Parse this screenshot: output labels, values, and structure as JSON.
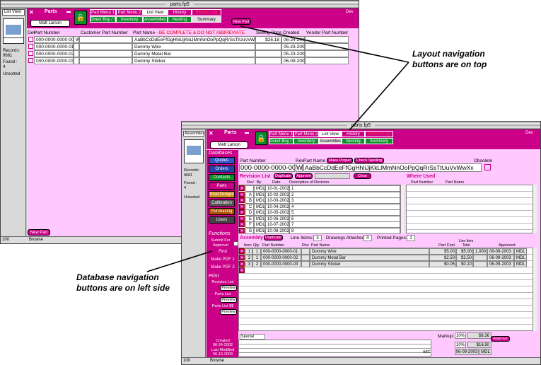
{
  "back_window": {
    "title": "parts.fp5",
    "layout_menu": "List View",
    "records_label": "Records:",
    "records_value": "9681",
    "found_label": "Found :",
    "found_value": "4",
    "sort_status": "Unsorted",
    "zoom": "100",
    "mode": "Browse",
    "app_label": "Parts",
    "user_button": "Matt Larson",
    "dev": "Dev",
    "new_part": "New Part",
    "new_part_small": "New Part",
    "tabs_row1": [
      "Part Menu 1",
      "Part Menu 2",
      "List View",
      "History",
      "Record Log"
    ],
    "tabs_row2": [
      "Direct Buy / Subcon",
      "Inventory",
      "Assemblies",
      "Nesting",
      "Summary"
    ],
    "columns": [
      "Part Number",
      "Customer Part Number",
      "Part Name - BE COMPLETE & DO NOT ABBREVIATE",
      "Selling Price",
      "Created",
      "Vendor Part Number"
    ],
    "col_prefix": "Dev",
    "rows": [
      {
        "pn": "000-0000-0000-00",
        "flag": "W",
        "cpn": "",
        "name": "AaBbCcDdEeFfGgHhIiJjKkLlMmNnOoPpQqRrSsTtUuVvWwXx",
        "price": "$26.18",
        "created": "06-24-2002",
        "vendor": ""
      },
      {
        "pn": "000-0000-0000-01",
        "flag": "",
        "cpn": "",
        "name": "Dummy Wire",
        "price": "",
        "created": "05-23-2003",
        "vendor": ""
      },
      {
        "pn": "000-0000-0000-02",
        "flag": "",
        "cpn": "",
        "name": "Dummy Metal Bar",
        "price": "",
        "created": "05-23-2003",
        "vendor": ""
      },
      {
        "pn": "000-0000-0000-03",
        "flag": "",
        "cpn": "",
        "name": "Dummy Sticker",
        "price": "",
        "created": "06-09-2003",
        "vendor": ""
      }
    ]
  },
  "front_window": {
    "title": "parts.fp5",
    "layout_menu": "Assemblies",
    "records_label": "Records:",
    "records_value": "9681",
    "found_label": "Found :",
    "found_value": "4",
    "sort_status": "Unsorted",
    "zoom": "100",
    "mode": "Browse",
    "app_label": "Parts",
    "user_button": "Matt Larson",
    "dev": "Dev",
    "tabs_row1": [
      "Part Menu 1",
      "Part Menu 2",
      "List View",
      "History",
      "Record Log"
    ],
    "tabs_row2": [
      "Direct Buy / Subcon",
      "Inventory",
      "Assemblies",
      "Nesting",
      "Summary"
    ],
    "databases_heading": "Databases",
    "databases": [
      {
        "label": "Quotes",
        "color": "#3355cc"
      },
      {
        "label": "Orders",
        "color": "#2244aa"
      },
      {
        "label": "Contacts",
        "color": "#0a8f2a"
      },
      {
        "label": "Parts",
        "color": "#cc0088"
      },
      {
        "label": "Prod Groups",
        "color": "#d09020"
      },
      {
        "label": "Calibration",
        "color": "#555555"
      },
      {
        "label": "Purchasing",
        "color": "#b05000"
      },
      {
        "label": "Users",
        "color": "#444444"
      }
    ],
    "functions_heading": "Functions",
    "functions": [
      "Submit For Approval",
      "Find",
      "Make PDF 1",
      "Make PDF 2"
    ],
    "print_heading": "Print",
    "print_items": [
      "Revision List",
      "Parts List",
      "Parts List $$"
    ],
    "preview": "Preview",
    "created_label": "Created",
    "created_value": "06-24-2002",
    "modified_label": "Last Modified",
    "modified_value": "06-13-2003",
    "part_number_label": "Part Number",
    "part_number": "000-0000-0000-00",
    "rev_label": "Rev",
    "rev": "W",
    "part_name_label": "Part Name",
    "make_proper": "Make Proper",
    "check_spelling": "Check Spelling",
    "part_name": "AaBbCcDdEeFfGgHhIiJjKkLlMmNnOoPpQqRrSsTtUuVvWwXx",
    "obsolete_label": "Obsolete",
    "revision_list_title": "Revision List",
    "duplicate": "Duplicate",
    "approve": "Approve",
    "clear": "Clear",
    "rev_cols": [
      "Rev",
      "By",
      "Date",
      "Description of Revision"
    ],
    "revisions": [
      {
        "rev": "",
        "by": "MDL",
        "date": "10-01-2002",
        "desc": "1"
      },
      {
        "rev": "A",
        "by": "MDL",
        "date": "10-02-2002",
        "desc": "2"
      },
      {
        "rev": "B",
        "by": "MDL",
        "date": "10-03-2002",
        "desc": "3"
      },
      {
        "rev": "C",
        "by": "MDL",
        "date": "10-04-2002",
        "desc": "4"
      },
      {
        "rev": "D",
        "by": "MDL",
        "date": "10-05-2002",
        "desc": "5"
      },
      {
        "rev": "E",
        "by": "MDL",
        "date": "10-06-2002",
        "desc": "6"
      },
      {
        "rev": "F",
        "by": "MDL",
        "date": "10-07-2002",
        "desc": "7"
      },
      {
        "rev": "G",
        "by": "MDL",
        "date": "10-08-2002",
        "desc": "8"
      }
    ],
    "where_used_title": "Where Used",
    "where_cols": [
      "Part Number",
      "Part Name"
    ],
    "assembly_title": "Assembly",
    "line_items_label": "Line Items:",
    "line_items": "3",
    "drawings_label": "Drawings Attached:",
    "drawings": "0",
    "printed_label": "Printed Pages:",
    "printed": "1",
    "asm_cols": [
      "Item",
      "Qty",
      "Part Number",
      "Rev",
      "Part Name",
      "Part Cost",
      "Line Item Total",
      "Approved"
    ],
    "assembly": [
      {
        "item": "1",
        "qty": "1",
        "pn": "000-0000-0000-01",
        "rev": "",
        "name": "Dummy Wire",
        "cost": "$5.00",
        "total": "$5.00",
        "qtyx": "1,000",
        "approved": "06-09-2003",
        "by": "MDL"
      },
      {
        "item": "2",
        "qty": "1",
        "pn": "000-0000-0000-02",
        "rev": "",
        "name": "Dummy Metal Bar",
        "cost": "$2.50",
        "total": "$2.50",
        "qtyx": "",
        "approved": "06-09-2003",
        "by": "MDL"
      },
      {
        "item": "3",
        "qty": "2",
        "pn": "000-0000-0000-03",
        "rev": "",
        "name": "Dummy Sticker",
        "cost": "$0.05",
        "total": "$0.10",
        "qtyx": "",
        "approved": "06-09-2003",
        "by": "MDL"
      }
    ],
    "special_notes": "Special Notes",
    "markup_label": "Markup:",
    "markup1": "10%",
    "markup1_val": "$8.36",
    "approve_btn": "Approve",
    "markup2": "10%",
    "markup2_val": "$16.50",
    "markup_date": "06-09-2003",
    "markup_by": "MDL",
    "abc": "ABC"
  },
  "callouts": {
    "top": "Layout navigation\nbuttons are on top",
    "left": "Database navigation\nbuttons are on left side"
  },
  "colors": {
    "accent": "#cc0088",
    "pink_bg": "#ffc8ff",
    "green": "#0a8f2a"
  }
}
